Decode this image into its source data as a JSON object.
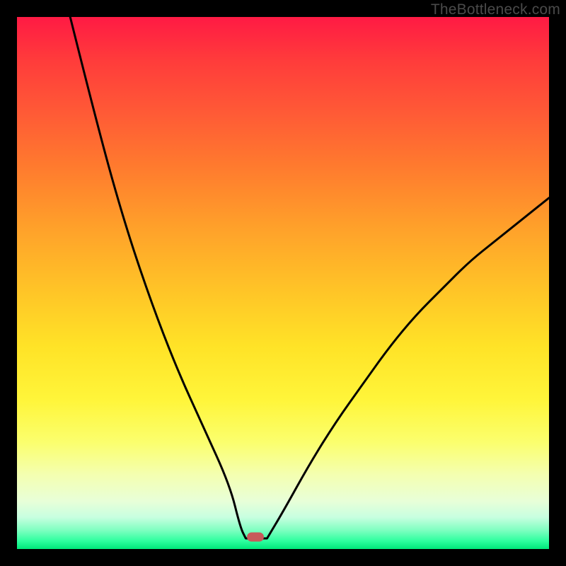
{
  "watermark": "TheBottleneck.com",
  "chart_data": {
    "type": "line",
    "title": "",
    "xlabel": "",
    "ylabel": "",
    "xlim": [
      0,
      100
    ],
    "ylim": [
      0,
      100
    ],
    "grid": false,
    "legend": "none",
    "series": [
      {
        "name": "left-branch",
        "x": [
          10,
          15,
          20,
          25,
          30,
          35,
          40,
          42,
          43
        ],
        "y": [
          100,
          80,
          62,
          47,
          34,
          23,
          12,
          4,
          2
        ]
      },
      {
        "name": "flat-bottom",
        "x": [
          43,
          47
        ],
        "y": [
          2,
          2
        ]
      },
      {
        "name": "right-branch",
        "x": [
          47,
          50,
          55,
          60,
          65,
          70,
          75,
          80,
          85,
          90,
          95,
          100
        ],
        "y": [
          2,
          7,
          16,
          24,
          31,
          38,
          44,
          49,
          54,
          58,
          62,
          66
        ]
      }
    ],
    "marker": {
      "x_fraction": 0.448,
      "y_fraction": 0.978
    },
    "colors": {
      "curve": "#000000",
      "marker": "#c85a5a",
      "gradient_top": "#ff1a44",
      "gradient_bottom": "#00e87a"
    }
  }
}
